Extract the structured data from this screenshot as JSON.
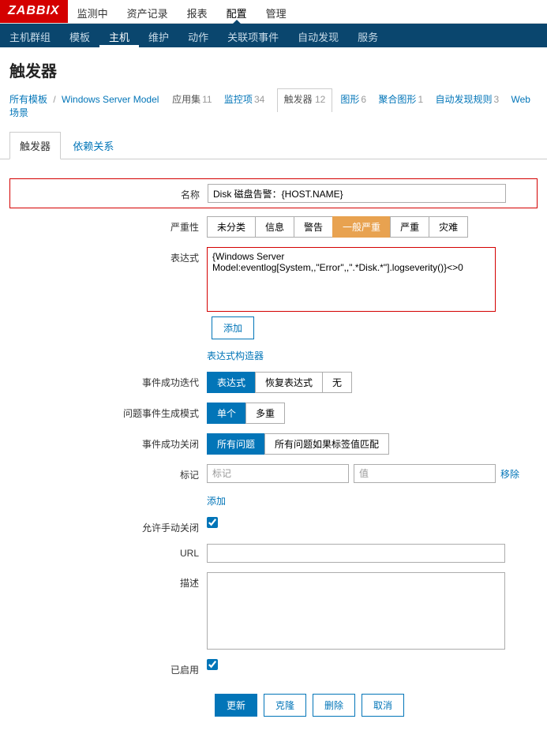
{
  "logo": "ZABBIX",
  "main_nav": {
    "items": [
      "监测中",
      "资产记录",
      "报表",
      "配置",
      "管理"
    ],
    "active": 3
  },
  "sub_nav": {
    "items": [
      "主机群组",
      "模板",
      "主机",
      "维护",
      "动作",
      "关联项事件",
      "自动发现",
      "服务"
    ],
    "active": 2
  },
  "page_title": "触发器",
  "crumbs": {
    "all_templates": "所有模板",
    "model": "Windows Server Model",
    "items": [
      {
        "label": "应用集",
        "count": "11",
        "link": false,
        "active": false
      },
      {
        "label": "监控项",
        "count": "34",
        "link": true,
        "active": false
      },
      {
        "label": "触发器",
        "count": "12",
        "link": false,
        "active": true
      },
      {
        "label": "图形",
        "count": "6",
        "link": true,
        "active": false
      },
      {
        "label": "聚合图形",
        "count": "1",
        "link": true,
        "active": false
      },
      {
        "label": "自动发现规则",
        "count": "3",
        "link": true,
        "active": false
      },
      {
        "label": "Web 场景",
        "count": "",
        "link": true,
        "active": false
      }
    ]
  },
  "tabs": {
    "t1": "触发器",
    "t2": "依赖关系"
  },
  "labels": {
    "name": "名称",
    "severity": "严重性",
    "expression": "表达式",
    "expr_builder": "表达式构造器",
    "event_ok_iter": "事件成功迭代",
    "problem_mode": "问题事件生成模式",
    "event_ok_close": "事件成功关闭",
    "tags": "标记",
    "allow_manual": "允许手动关闭",
    "url": "URL",
    "description": "描述",
    "enabled": "已启用"
  },
  "values": {
    "name": "Disk 磁盘告警：{HOST.NAME}",
    "expression": "{Windows Server Model:eventlog[System,,\"Error\",,\".*Disk.*\"].logseverity()}<>0",
    "url": "",
    "description": ""
  },
  "severity_opts": [
    "未分类",
    "信息",
    "警告",
    "一般严重",
    "严重",
    "灾难"
  ],
  "event_ok_iter_opts": [
    "表达式",
    "恢复表达式",
    "无"
  ],
  "problem_mode_opts": [
    "单个",
    "多重"
  ],
  "event_ok_close_opts": [
    "所有问题",
    "所有问题如果标签值匹配"
  ],
  "buttons": {
    "add": "添加",
    "add_tag": "添加",
    "remove": "移除",
    "update": "更新",
    "clone": "克隆",
    "delete": "删除",
    "cancel": "取消"
  },
  "placeholders": {
    "tag_key": "标记",
    "tag_val": "值"
  }
}
